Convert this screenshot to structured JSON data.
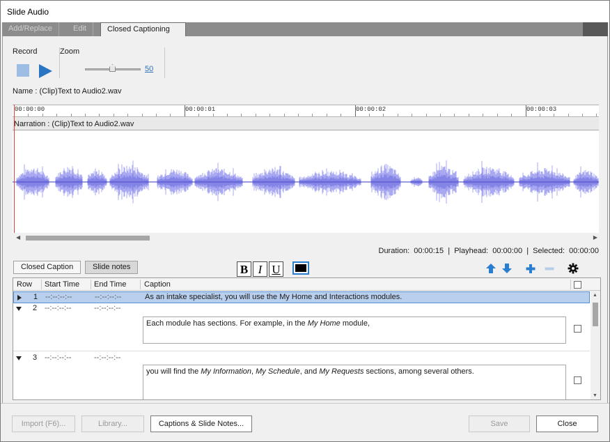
{
  "window": {
    "title": "Slide Audio"
  },
  "tabs": [
    "Add/Replace",
    "Edit",
    "Closed Captioning"
  ],
  "record": {
    "label": "Record"
  },
  "zoom": {
    "label": "Zoom",
    "value": "50"
  },
  "clip": {
    "name": "Name :  (Clip)Text to Audio2.wav"
  },
  "timeline": {
    "ticks": [
      "00:00:00",
      "00:00:01",
      "00:00:02",
      "00:00:03"
    ]
  },
  "narration": {
    "label": "Narration : (Clip)Text to Audio2.wav"
  },
  "status": {
    "duration_label": "Duration:",
    "duration": "00:00:15",
    "playhead_label": "Playhead:",
    "playhead": "00:00:00",
    "selected_label": "Selected:",
    "selected": "00:00:00"
  },
  "subtabs": {
    "closed_caption": "Closed Caption",
    "slide_notes": "Slide notes"
  },
  "format": {
    "bold": "B",
    "italic": "I",
    "underline": "U",
    "text_color": "#000000"
  },
  "grid": {
    "headers": {
      "row": "Row",
      "start": "Start Time",
      "end": "End Time",
      "caption": "Caption"
    },
    "rows": [
      {
        "num": "1",
        "start": "--:--:--:--",
        "end": "--:--:--:--",
        "caption": "As an intake specialist, you will use the My Home and Interactions modules."
      },
      {
        "num": "2",
        "start": "--:--:--:--",
        "end": "--:--:--:--",
        "caption_parts": [
          "Each module has sections. For example, in the ",
          "My Home",
          " module,"
        ]
      },
      {
        "num": "3",
        "start": "--:--:--:--",
        "end": "--:--:--:--",
        "caption_parts": [
          "you will find the ",
          "My Information",
          ", ",
          "My Schedule",
          ", and ",
          "My Requests",
          " sections, among several others."
        ]
      }
    ]
  },
  "buttons": {
    "import": "Import (F6)...",
    "library": "Library...",
    "captions_notes": "Captions & Slide Notes...",
    "save": "Save",
    "close": "Close"
  }
}
